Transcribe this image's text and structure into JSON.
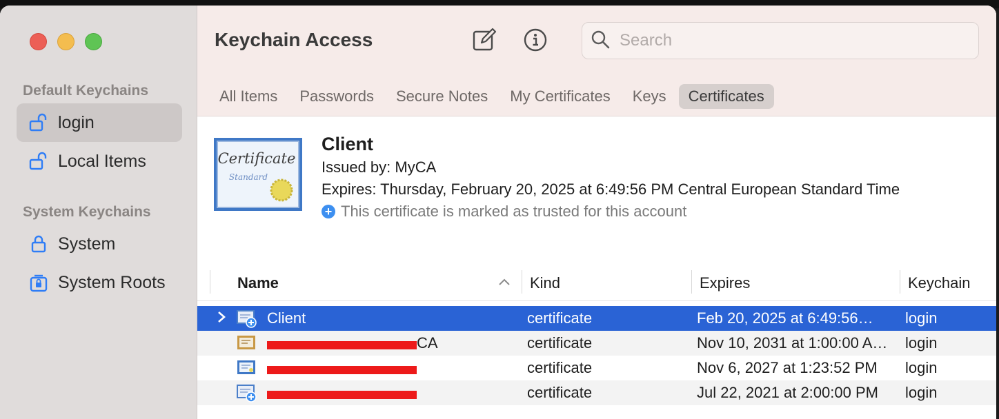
{
  "sidebar": {
    "default_header": "Default Keychains",
    "default_items": [
      {
        "label": "login",
        "icon": "unlocked-lock-icon"
      },
      {
        "label": "Local Items",
        "icon": "unlocked-lock-icon"
      }
    ],
    "system_header": "System Keychains",
    "system_items": [
      {
        "label": "System",
        "icon": "lock-icon"
      },
      {
        "label": "System Roots",
        "icon": "cabinet-lock-icon"
      }
    ]
  },
  "toolbar": {
    "title": "Keychain Access",
    "search_placeholder": "Search"
  },
  "tabs": [
    "All Items",
    "Passwords",
    "Secure Notes",
    "My Certificates",
    "Keys",
    "Certificates"
  ],
  "active_tab": "Certificates",
  "detail": {
    "name": "Client",
    "issued_by": "Issued by: MyCA",
    "expires": "Expires: Thursday, February 20, 2025 at 6:49:56 PM Central European Standard Time",
    "trust": "This certificate is marked as trusted for this account",
    "image_text_1": "Certificate",
    "image_text_2": "Standard"
  },
  "table": {
    "columns": [
      "Name",
      "Kind",
      "Expires",
      "Keychain"
    ],
    "rows": [
      {
        "name": "Client",
        "kind": "certificate",
        "expires": "Feb 20, 2025 at 6:49:56…",
        "keychain": "login"
      },
      {
        "name": "CA",
        "kind": "certificate",
        "expires": "Nov 10, 2031 at 1:00:00 A…",
        "keychain": "login"
      },
      {
        "name": "",
        "kind": "certificate",
        "expires": "Nov 6, 2027 at 1:23:52 PM",
        "keychain": "login"
      },
      {
        "name": "",
        "kind": "certificate",
        "expires": "Jul 22, 2021 at 2:00:00 PM",
        "keychain": "login"
      }
    ]
  },
  "colors": {
    "selection": "#2a63d5",
    "redaction": "#ed1a1a",
    "toolbar_bg": "#f6ebe9",
    "sidebar_bg": "#e0dcdb"
  }
}
